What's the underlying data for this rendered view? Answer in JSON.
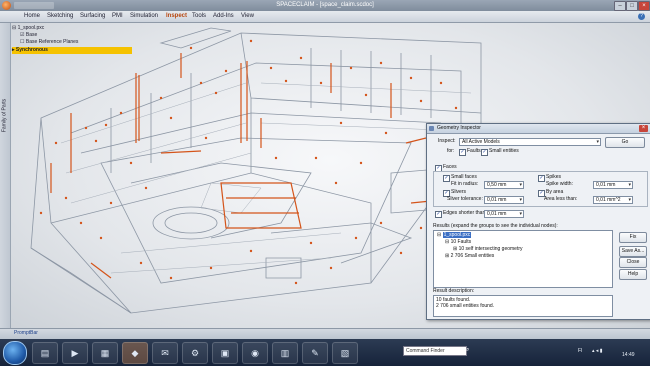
{
  "app": {
    "title": "SPACECLAIM - [space_claim.scdoc]"
  },
  "ribbon_tabs": [
    "Home",
    "Sketching",
    "Surfacing",
    "PMI",
    "Simulation",
    "Inspect",
    "Tools",
    "Add-Ins",
    "View"
  ],
  "active_tab": "Inspect",
  "window_controls": {
    "minimize": "–",
    "maximize": "□",
    "close": "×"
  },
  "tree": {
    "root": "1_spool.pxc",
    "items": [
      "Base",
      "Base Reference Planes",
      "Synchronous"
    ]
  },
  "left_strip": {
    "label": "Family of Parts"
  },
  "dialog": {
    "title": "Geometry Inspector",
    "inspect_label": "Inspect:",
    "inspect_value": "All Active Models",
    "go_button": "Go",
    "for_label": "for:",
    "for_faults": "Faults",
    "for_small": "Small entities",
    "faces_label": "Faces",
    "small_faces": "Small faces",
    "fit_in_radius": "Fit in radius:",
    "fit_in_radius_value": "0,50 mm",
    "spikes": "Spikes",
    "spike_width": "Spike width:",
    "spike_width_value": "0,01 mm",
    "slivers": "Slivers",
    "sliver_tolerance": "Sliver tolerance:",
    "sliver_tolerance_value": "0,01 mm",
    "by_area": "By area",
    "area_less_than": "Area less than:",
    "area_less_than_value": "0,01 mm^2",
    "edges_label": "Edges shorter than:",
    "edges_value": "0,01 mm",
    "results_label": "Results (expand the groups to see the individual nodes):",
    "results_tree": [
      "1_spool.pxc",
      "10 Faults",
      "10 self intersecting geometry",
      "2 706 Small entities"
    ],
    "fix_button": "Fix",
    "save_as_button": "Save As...",
    "close_button": "Close",
    "help_button": "Help",
    "result_desc_label": "Result description:",
    "result_desc_lines": [
      "10 faults found.",
      "2 706 small entities found."
    ],
    "close_glyph": "×"
  },
  "prompt_bar": {
    "label": "PromptBar"
  },
  "taskbar": {
    "command_finder": "Command Finder",
    "language": "FI",
    "clock": "14:49"
  },
  "colors": {
    "accent_orange": "#d4541a",
    "highlight_yellow": "#f5c200",
    "wire": "#8c96a4"
  }
}
